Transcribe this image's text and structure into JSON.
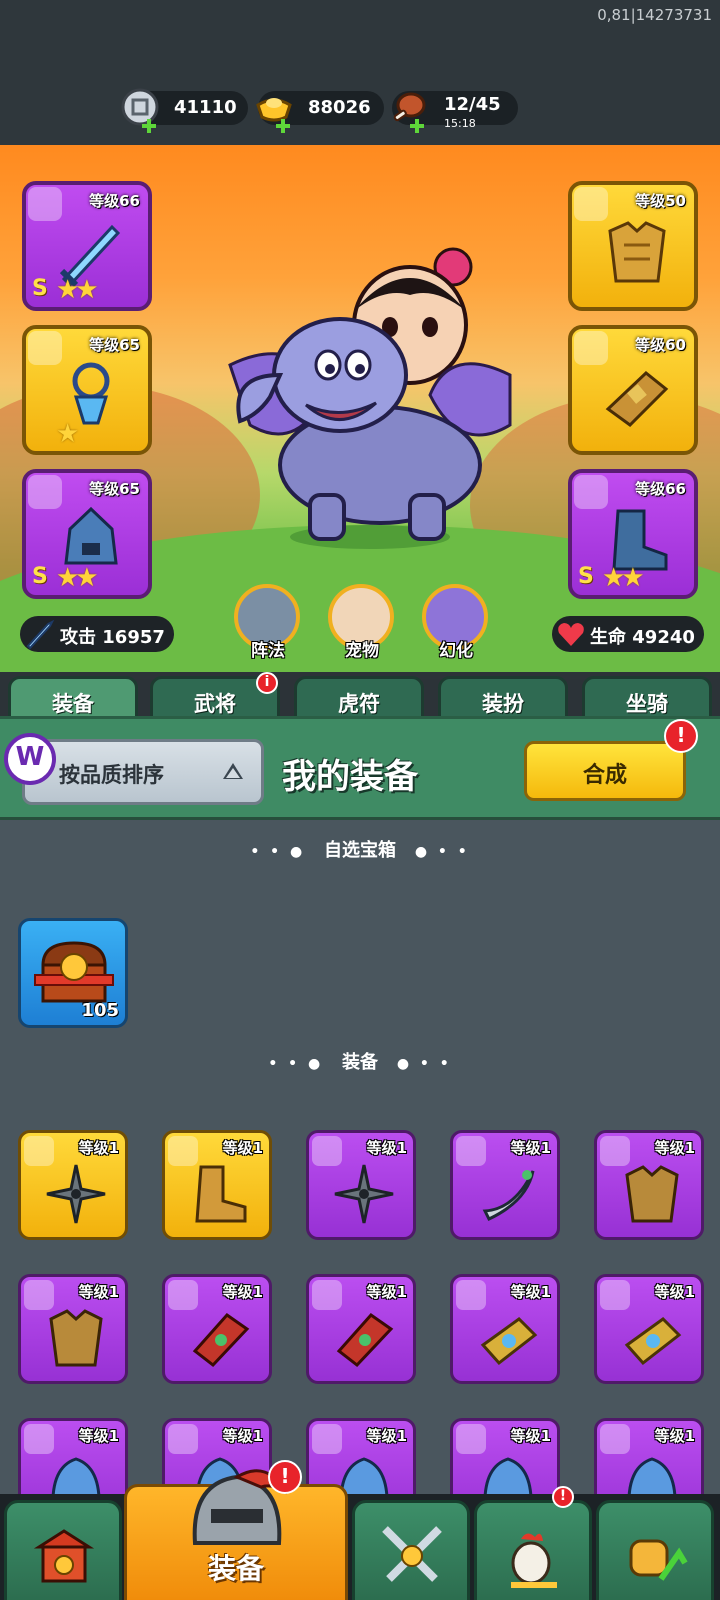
{
  "debug_text": "0,81|14273731",
  "resources": [
    {
      "name": "silver-coin",
      "value": "41110"
    },
    {
      "name": "gold-ingot",
      "value": "88026"
    },
    {
      "name": "stamina",
      "value": "12/45",
      "timer": "15:18"
    }
  ],
  "equipped_left": [
    {
      "level": "等级66",
      "grade": "S",
      "stars": "★★",
      "rarity": "purple",
      "type": "weapon"
    },
    {
      "level": "等级65",
      "grade": "",
      "stars": "★",
      "rarity": "gold",
      "type": "amulet"
    },
    {
      "level": "等级65",
      "grade": "S",
      "stars": "★★",
      "rarity": "purple",
      "type": "helmet"
    }
  ],
  "equipped_right": [
    {
      "level": "等级50",
      "grade": "",
      "stars": "",
      "rarity": "gold",
      "type": "armor"
    },
    {
      "level": "等级60",
      "grade": "",
      "stars": "",
      "rarity": "gold",
      "type": "bracer"
    },
    {
      "level": "等级66",
      "grade": "S",
      "stars": "★★",
      "rarity": "purple",
      "type": "boots"
    }
  ],
  "stats": {
    "attack_label": "攻击 16957",
    "hp_label": "生命 49240"
  },
  "mid_buttons": [
    {
      "label": "阵法"
    },
    {
      "label": "宠物"
    },
    {
      "label": "幻化"
    }
  ],
  "tabs": [
    {
      "label": "装备",
      "active": true
    },
    {
      "label": "武将",
      "alert": "i"
    },
    {
      "label": "虎符"
    },
    {
      "label": "装扮"
    },
    {
      "label": "坐骑"
    }
  ],
  "header": {
    "logo_text": "W",
    "sort_label": "按品质排序",
    "title": "我的装备",
    "synth_label": "合成",
    "synth_alert": "!"
  },
  "sections": {
    "chest_title": "自选宝箱",
    "equip_title": "装备",
    "dots_left": "• • ●",
    "dots_right": "● • •"
  },
  "chest": {
    "count": "105"
  },
  "items": [
    {
      "level": "等级1",
      "rarity": "gold",
      "type": "shuriken"
    },
    {
      "level": "等级1",
      "rarity": "gold",
      "type": "boots"
    },
    {
      "level": "等级1",
      "rarity": "purple",
      "type": "shuriken"
    },
    {
      "level": "等级1",
      "rarity": "purple",
      "type": "scimitar"
    },
    {
      "level": "等级1",
      "rarity": "purple",
      "type": "armor"
    },
    {
      "level": "等级1",
      "rarity": "purple",
      "type": "armor"
    },
    {
      "level": "等级1",
      "rarity": "purple",
      "type": "bracer"
    },
    {
      "level": "等级1",
      "rarity": "purple",
      "type": "bracer"
    },
    {
      "level": "等级1",
      "rarity": "purple",
      "type": "gauntlet"
    },
    {
      "level": "等级1",
      "rarity": "purple",
      "type": "gauntlet"
    },
    {
      "level": "等级1",
      "rarity": "purple",
      "type": "helmet"
    },
    {
      "level": "等级1",
      "rarity": "purple",
      "type": "helmet"
    },
    {
      "level": "等级1",
      "rarity": "purple",
      "type": "helmet"
    },
    {
      "level": "等级1",
      "rarity": "purple",
      "type": "helmet"
    },
    {
      "level": "等级1",
      "rarity": "purple",
      "type": "helmet"
    }
  ],
  "bottom_nav": [
    {
      "label": "",
      "icon": "gate-icon"
    },
    {
      "label": "装备",
      "icon": "helmet-icon",
      "active": true,
      "alert": "!"
    },
    {
      "label": "",
      "icon": "swords-icon"
    },
    {
      "label": "",
      "icon": "rooster-icon",
      "alert": "!"
    },
    {
      "label": "",
      "icon": "fist-upgrade-icon"
    }
  ]
}
